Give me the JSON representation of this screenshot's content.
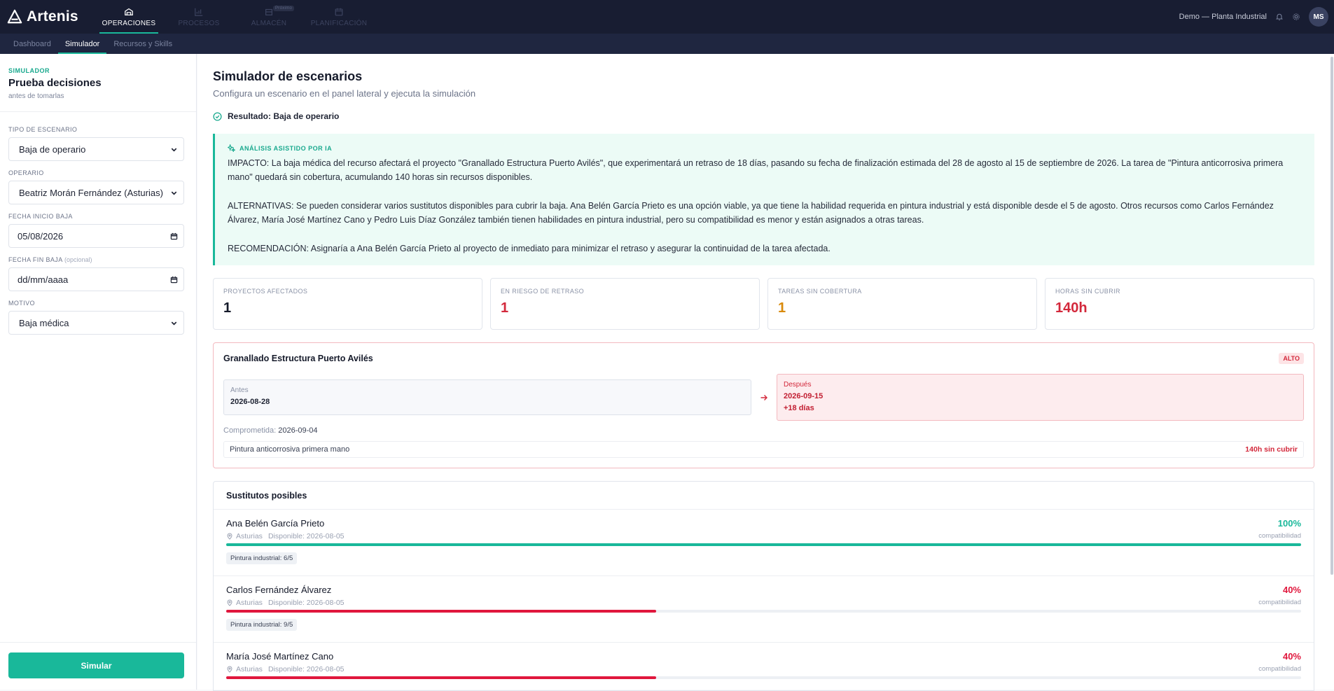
{
  "app": {
    "name": "Artenis",
    "workspace": "Demo — Planta Industrial",
    "user_initials": "MS"
  },
  "topnav": [
    {
      "label": "OPERACIONES",
      "icon": "factory-icon",
      "active": true
    },
    {
      "label": "PROCESOS",
      "icon": "chart-icon",
      "active": false
    },
    {
      "label": "ALMACÉN",
      "icon": "warehouse-icon",
      "active": false,
      "badge": "Próximo"
    },
    {
      "label": "PLANIFICACIÓN",
      "icon": "calendar-icon",
      "active": false
    }
  ],
  "subnav": [
    {
      "label": "Dashboard",
      "active": false
    },
    {
      "label": "Simulador",
      "active": true
    },
    {
      "label": "Recursos y Skills",
      "active": false
    }
  ],
  "sidebar": {
    "eyebrow": "SIMULADOR",
    "title": "Prueba decisiones",
    "subtitle": "antes de tomarlas",
    "fields": {
      "scenario_label": "TIPO DE ESCENARIO",
      "scenario_value": "Baja de operario",
      "operator_label": "OPERARIO",
      "operator_value": "Beatriz Morán Fernández (Asturias)",
      "start_label": "FECHA INICIO BAJA",
      "start_value": "05/08/2026",
      "end_label": "FECHA FIN BAJA",
      "end_optional": "(opcional)",
      "end_value": "dd/mm/aaaa",
      "reason_label": "MOTIVO",
      "reason_value": "Baja médica"
    },
    "simulate_button": "Simular"
  },
  "main": {
    "title": "Simulador de escenarios",
    "subtitle": "Configura un escenario en el panel lateral y ejecuta la simulación",
    "result": "Resultado: Baja de operario",
    "ai": {
      "tag": "ANÁLISIS ASISTIDO POR IA",
      "impact": "IMPACTO: La baja médica del recurso afectará el proyecto \"Granallado Estructura Puerto Avilés\", que experimentará un retraso de 18 días, pasando su fecha de finalización estimada del 28 de agosto al 15 de septiembre de 2026. La tarea de \"Pintura anticorrosiva primera mano\" quedará sin cobertura, acumulando 140 horas sin recursos disponibles.",
      "alternatives": "ALTERNATIVAS: Se pueden considerar varios sustitutos disponibles para cubrir la baja. Ana Belén García Prieto es una opción viable, ya que tiene la habilidad requerida en pintura industrial y está disponible desde el 5 de agosto. Otros recursos como Carlos Fernández Álvarez, María José Martínez Cano y Pedro Luis Díaz González también tienen habilidades en pintura industrial, pero su compatibilidad es menor y están asignados a otras tareas.",
      "recommendation": "RECOMENDACIÓN: Asignaría a Ana Belén García Prieto al proyecto de inmediato para minimizar el retraso y asegurar la continuidad de la tarea afectada."
    },
    "kpis": [
      {
        "label": "PROYECTOS AFECTADOS",
        "value": "1",
        "color": "#151a2a"
      },
      {
        "label": "EN RIESGO DE RETRASO",
        "value": "1",
        "color": "#d3283b"
      },
      {
        "label": "TAREAS SIN COBERTURA",
        "value": "1",
        "color": "#d98a0b"
      },
      {
        "label": "HORAS SIN CUBRIR",
        "value": "140h",
        "color": "#d3283b"
      }
    ],
    "project": {
      "name": "Granallado Estructura Puerto Avilés",
      "risk": "ALTO",
      "before_label": "Antes",
      "before_value": "2026-08-28",
      "after_label": "Después",
      "after_value": "2026-09-15",
      "after_delta": "+18 días",
      "committed_label": "Comprometida:",
      "committed_value": "2026-09-04",
      "task": "Pintura anticorrosiva primera mano",
      "task_warning": "140h sin cubrir"
    },
    "substitutes": {
      "title": "Sustitutos posibles",
      "compat_label": "compatibilidad",
      "items": [
        {
          "name": "Ana Belén García Prieto",
          "location": "Asturias",
          "available": "Disponible: 2026-08-05",
          "pct": "100%",
          "fraction": 1.0,
          "color": "#19b89a",
          "skill": "Pintura industrial: 6/5"
        },
        {
          "name": "Carlos Fernández Álvarez",
          "location": "Asturias",
          "available": "Disponible: 2026-08-05",
          "pct": "40%",
          "fraction": 0.4,
          "color": "#e0173d",
          "skill": "Pintura industrial: 9/5"
        },
        {
          "name": "María José Martínez Cano",
          "location": "Asturias",
          "available": "Disponible: 2026-08-05",
          "pct": "40%",
          "fraction": 0.4,
          "color": "#e0173d",
          "skill": ""
        }
      ]
    }
  }
}
